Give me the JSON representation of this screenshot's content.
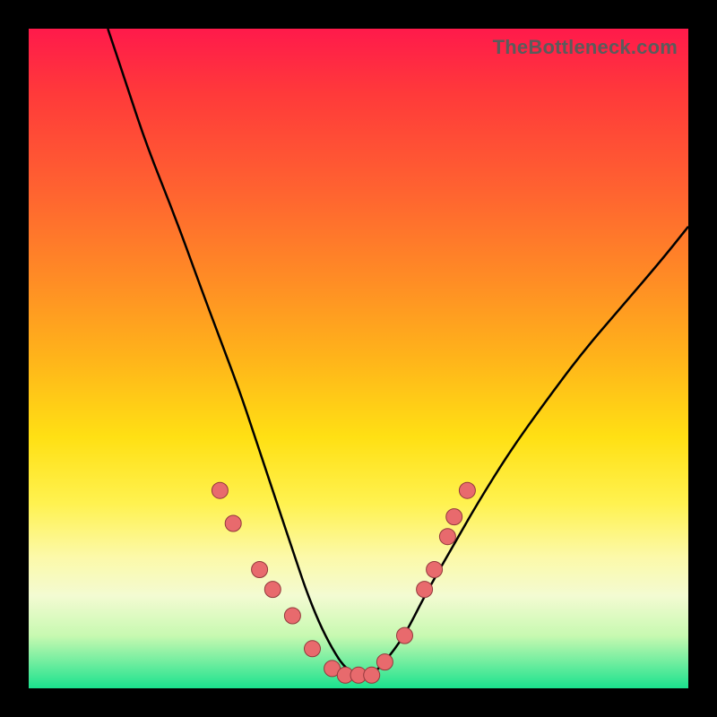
{
  "watermark": "TheBottleneck.com",
  "colors": {
    "frame": "#000000",
    "gradient_top": "#ff1a4b",
    "gradient_bottom": "#1be28e",
    "curve": "#000000",
    "dot_fill": "#e86a6d",
    "dot_stroke": "#92393c"
  },
  "chart_data": {
    "type": "line",
    "title": "",
    "xlabel": "",
    "ylabel": "",
    "xlim": [
      0,
      100
    ],
    "ylim": [
      0,
      100
    ],
    "grid": false,
    "legend": false,
    "annotations": [
      "TheBottleneck.com"
    ],
    "series": [
      {
        "name": "bottleneck-curve",
        "x": [
          12,
          15,
          18,
          22,
          26,
          29,
          32,
          34,
          36,
          38,
          40,
          42,
          44,
          46,
          48,
          50,
          52,
          54,
          57,
          60,
          64,
          68,
          73,
          78,
          84,
          90,
          96,
          100
        ],
        "y": [
          100,
          91,
          82,
          72,
          61,
          53,
          45,
          39,
          33,
          27,
          21,
          15,
          10,
          6,
          3,
          2,
          2,
          4,
          8,
          14,
          21,
          28,
          36,
          43,
          51,
          58,
          65,
          70
        ]
      }
    ],
    "markers": [
      {
        "x": 29.0,
        "y": 30.0
      },
      {
        "x": 31.0,
        "y": 25.0
      },
      {
        "x": 35.0,
        "y": 18.0
      },
      {
        "x": 37.0,
        "y": 15.0
      },
      {
        "x": 40.0,
        "y": 11.0
      },
      {
        "x": 43.0,
        "y": 6.0
      },
      {
        "x": 46.0,
        "y": 3.0
      },
      {
        "x": 48.0,
        "y": 2.0
      },
      {
        "x": 50.0,
        "y": 2.0
      },
      {
        "x": 52.0,
        "y": 2.0
      },
      {
        "x": 54.0,
        "y": 4.0
      },
      {
        "x": 57.0,
        "y": 8.0
      },
      {
        "x": 60.0,
        "y": 15.0
      },
      {
        "x": 61.5,
        "y": 18.0
      },
      {
        "x": 63.5,
        "y": 23.0
      },
      {
        "x": 64.5,
        "y": 26.0
      },
      {
        "x": 66.5,
        "y": 30.0
      }
    ]
  }
}
